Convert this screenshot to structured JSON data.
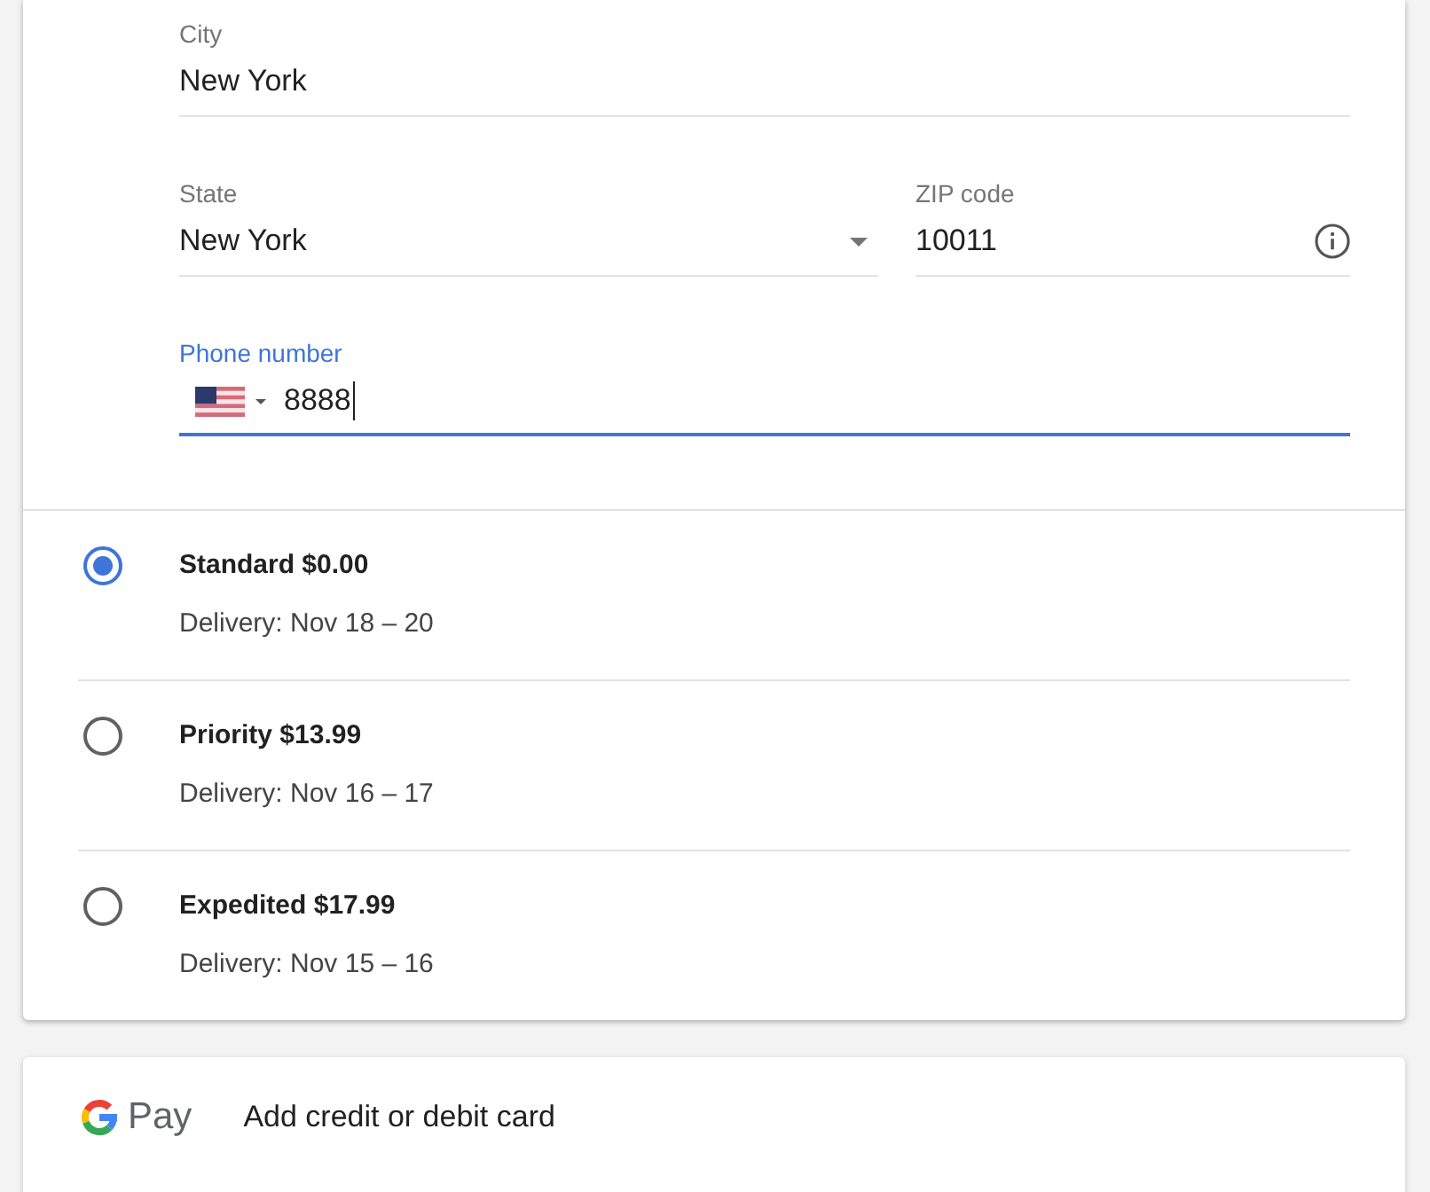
{
  "address_form": {
    "rows": [
      {
        "fields": [
          {
            "kind": "text",
            "label": "City",
            "value": "New York",
            "focused": false
          }
        ]
      },
      {
        "fields": [
          {
            "kind": "select",
            "label": "State",
            "value": "New York",
            "focused": false
          },
          {
            "kind": "info",
            "label": "ZIP code",
            "value": "10011",
            "focused": false
          }
        ]
      },
      {
        "fields": [
          {
            "kind": "phone",
            "label": "Phone number",
            "value": "8888",
            "focused": true
          }
        ]
      }
    ]
  },
  "shipping_options": [
    {
      "title": "Standard $0.00",
      "delivery": "Delivery: Nov 18 – 20",
      "selected": true
    },
    {
      "title": "Priority $13.99",
      "delivery": "Delivery: Nov 16 – 17",
      "selected": false
    },
    {
      "title": "Expedited $17.99",
      "delivery": "Delivery: Nov 15 – 16",
      "selected": false
    }
  ],
  "payment": {
    "logo_text": "Pay",
    "action": "Add credit or debit card"
  }
}
